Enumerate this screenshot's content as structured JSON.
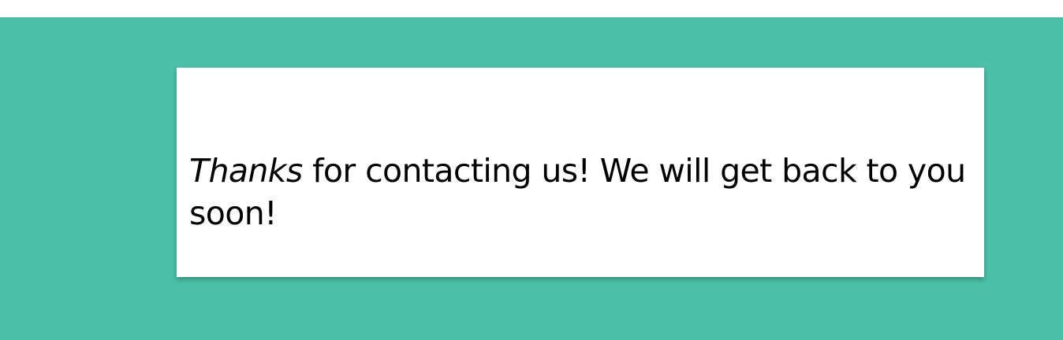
{
  "colors": {
    "background_top": "#ffffff",
    "section_background": "#4bc0a7",
    "card_background": "#ffffff",
    "text": "#000000"
  },
  "message": {
    "emphasis": "Thanks",
    "rest": " for contacting us! We will get back to you soon!"
  }
}
